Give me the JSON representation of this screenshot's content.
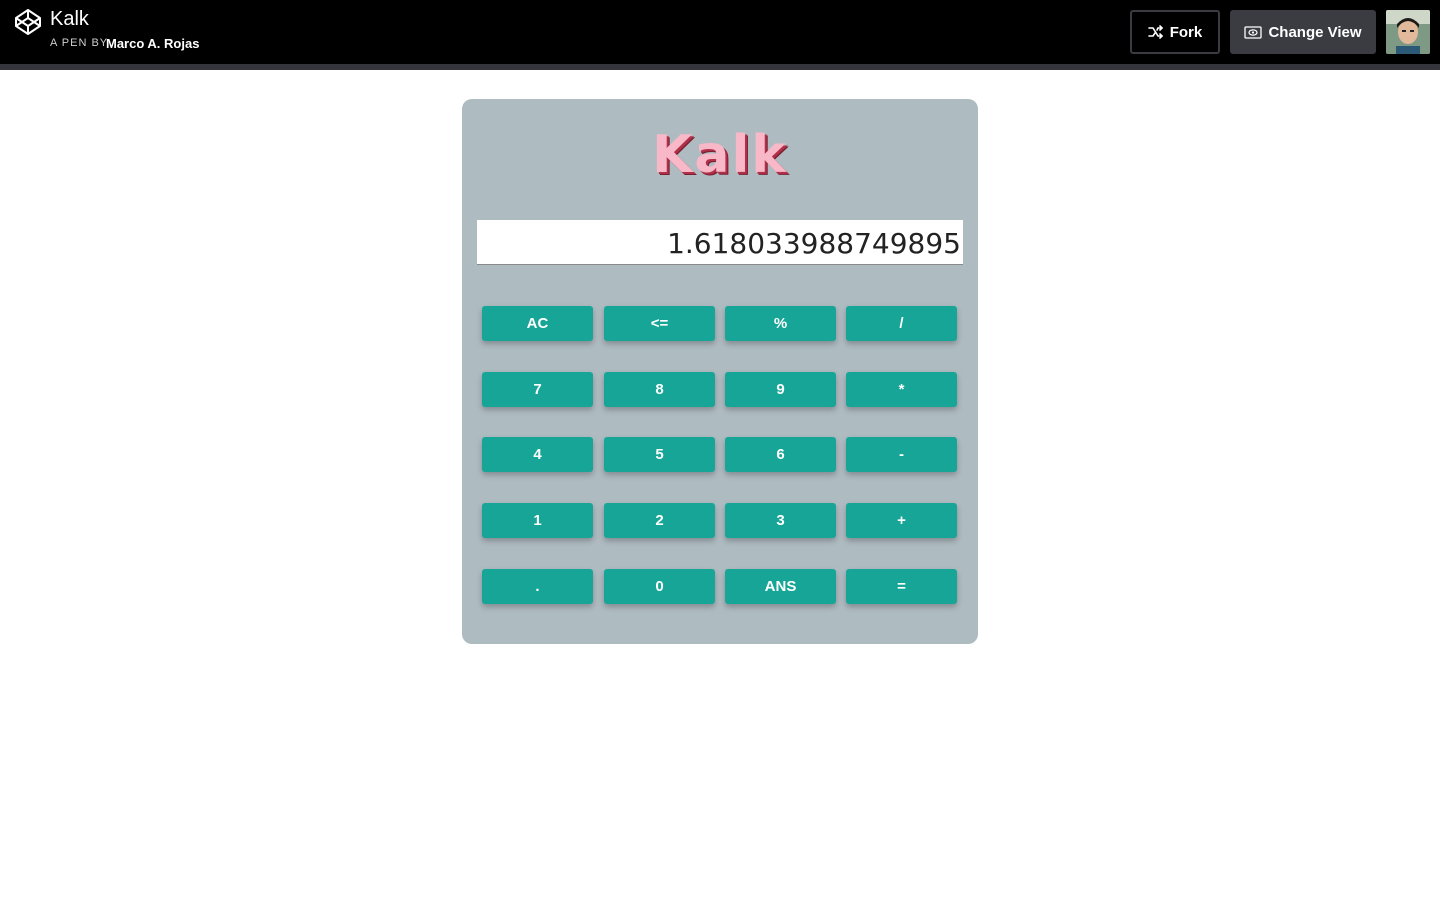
{
  "header": {
    "pen_title": "Kalk",
    "pen_by": "A PEN BY",
    "author": "Marco A. Rojas",
    "fork_label": "Fork",
    "change_view_label": "Change View"
  },
  "calculator": {
    "title": "Kalk",
    "display_value": "1.618033988749895",
    "keys": [
      [
        "AC",
        "<=",
        "%",
        "/"
      ],
      [
        "7",
        "8",
        "9",
        "*"
      ],
      [
        "4",
        "5",
        "6",
        "-"
      ],
      [
        "1",
        "2",
        "3",
        "+"
      ],
      [
        ".",
        "0",
        "ANS",
        "="
      ]
    ]
  },
  "colors": {
    "topbar": "#000000",
    "calc_body": "#aebbc1",
    "key": "#16a596",
    "title_fill": "#f8b8c8",
    "title_shadow": "#b0304a"
  },
  "icons": {
    "logo": "codepen-logo-icon",
    "fork": "fork-icon",
    "change_view": "eye-view-icon"
  }
}
